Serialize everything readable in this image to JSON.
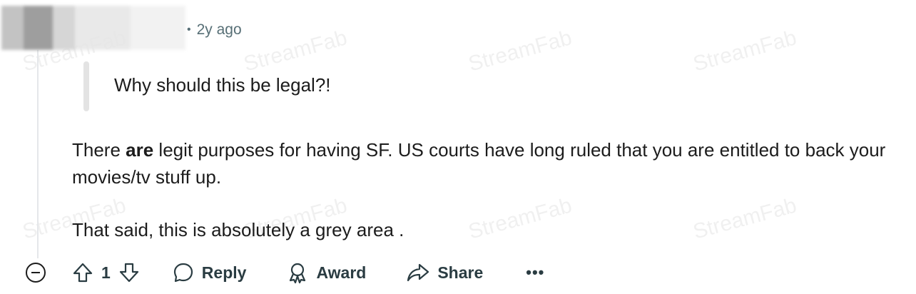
{
  "comment": {
    "timestamp": "2y ago",
    "quote": "Why should this be legal?!",
    "para1_before": "There ",
    "para1_bold": "are",
    "para1_after": " legit purposes for having SF. US courts have long ruled that you are entitled to back your movies/tv stuff up.",
    "para2": "That said, this is absolutely a grey area ."
  },
  "actions": {
    "vote_count": "1",
    "reply_label": "Reply",
    "award_label": "Award",
    "share_label": "Share",
    "more_label": "•••"
  },
  "watermark": "StreamFab",
  "icons": [
    "collapse-icon",
    "upvote-icon",
    "downvote-icon",
    "reply-icon",
    "award-icon",
    "share-icon",
    "more-icon"
  ]
}
